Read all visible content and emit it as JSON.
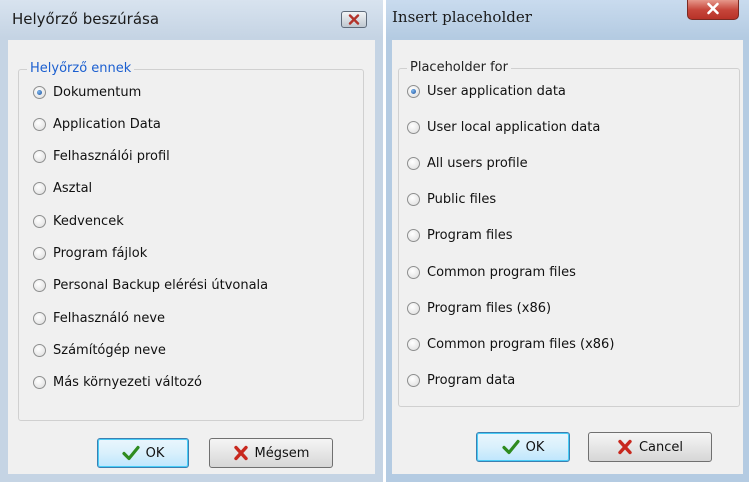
{
  "left_dialog": {
    "title": "Helyőrző beszúrása",
    "group_label": "Helyőrző ennek",
    "options": [
      {
        "label": "Dokumentum",
        "checked": true
      },
      {
        "label": "Application Data",
        "checked": false
      },
      {
        "label": "Felhasználói profil",
        "checked": false
      },
      {
        "label": "Asztal",
        "checked": false
      },
      {
        "label": "Kedvencek",
        "checked": false
      },
      {
        "label": "Program fájlok",
        "checked": false
      },
      {
        "label": "Personal Backup elérési útvonala",
        "checked": false
      },
      {
        "label": "Felhasználó neve",
        "checked": false
      },
      {
        "label": "Számítógép neve",
        "checked": false
      },
      {
        "label": "Más környezeti változó",
        "checked": false
      }
    ],
    "ok_label": "OK",
    "cancel_label": "Mégsem"
  },
  "right_dialog": {
    "title": "Insert placeholder",
    "group_label": "Placeholder for",
    "options": [
      {
        "label": "User application data",
        "checked": true
      },
      {
        "label": "User local application data",
        "checked": false
      },
      {
        "label": "All users profile",
        "checked": false
      },
      {
        "label": "Public files",
        "checked": false
      },
      {
        "label": "Program files",
        "checked": false
      },
      {
        "label": "Common program files",
        "checked": false
      },
      {
        "label": "Program files (x86)",
        "checked": false
      },
      {
        "label": "Common program files (x86)",
        "checked": false
      },
      {
        "label": "Program data",
        "checked": false
      }
    ],
    "ok_label": "OK",
    "cancel_label": "Cancel"
  },
  "colors": {
    "check_icon": "#2e8b1f",
    "x_icon": "#c8281e",
    "legend_blue": "#1b5fd0"
  },
  "icons": {
    "close": "close-icon",
    "ok": "checkmark-icon",
    "cancel": "x-icon"
  }
}
